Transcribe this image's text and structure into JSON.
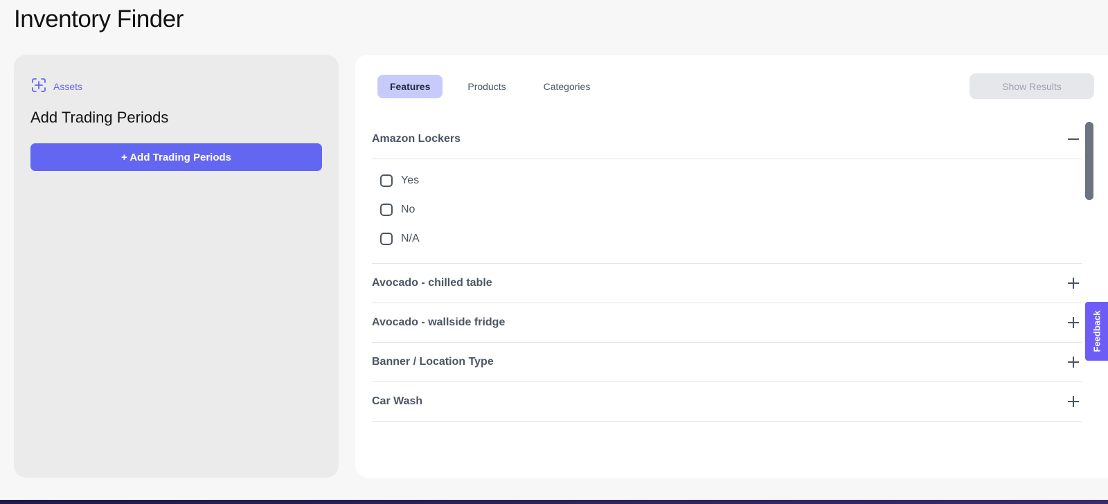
{
  "page": {
    "title": "Inventory Finder"
  },
  "left_panel": {
    "assets_label": "Assets",
    "heading": "Add Trading Periods",
    "add_button_label": "+ Add Trading Periods"
  },
  "tabs": [
    {
      "label": "Features",
      "active": true
    },
    {
      "label": "Products",
      "active": false
    },
    {
      "label": "Categories",
      "active": false
    }
  ],
  "show_results_label": "Show Results",
  "accordion": {
    "expanded": {
      "title": "Amazon Lockers",
      "options": [
        "Yes",
        "No",
        "N/A"
      ]
    },
    "collapsed": [
      "Avocado - chilled table",
      "Avocado - wallside fridge",
      "Banner / Location Type",
      "Car Wash"
    ]
  },
  "feedback_label": "Feedback",
  "colors": {
    "accent": "#6366f1",
    "active_tab_bg": "#c7cbfa",
    "feedback_bg": "#6d5df6"
  }
}
